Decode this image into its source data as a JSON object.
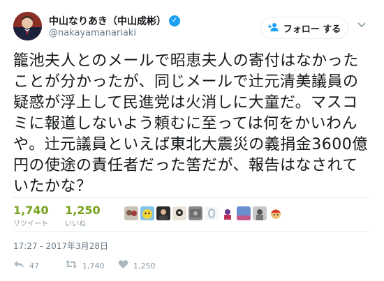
{
  "author": {
    "display_name": "中山なりあき（中山成彬）",
    "handle": "@nakayamanariaki",
    "verified_icon": "verified-badge-icon"
  },
  "header": {
    "follow_label": "フォロー する",
    "follow_icon": "add-user-icon",
    "more_icon": "chevron-down-icon"
  },
  "tweet": {
    "text": "籠池夫人とのメールで昭恵夫人の寄付はなかったことが分かったが、同じメールで辻元清美議員の疑惑が浮上して民進党は火消しに大童だ。マスコミに報道しないよう頼むに至っては何をかいわんや。辻元議員といえば東北大震災の義捐金3600億円の使途の責任者だった筈だが、報告はなされていたかな？"
  },
  "stats": {
    "retweets_count": "1,740",
    "retweets_label": "リツイート",
    "likes_count": "1,250",
    "likes_label": "いいね"
  },
  "timestamp": "17:27 - 2017年3月28日",
  "actions": {
    "reply_count": "47",
    "retweet_count": "1,740",
    "like_count": "1,250"
  },
  "colors": {
    "accent_blue": "#1da1f2",
    "stat_green": "#76a11c",
    "muted": "#8899a6"
  }
}
